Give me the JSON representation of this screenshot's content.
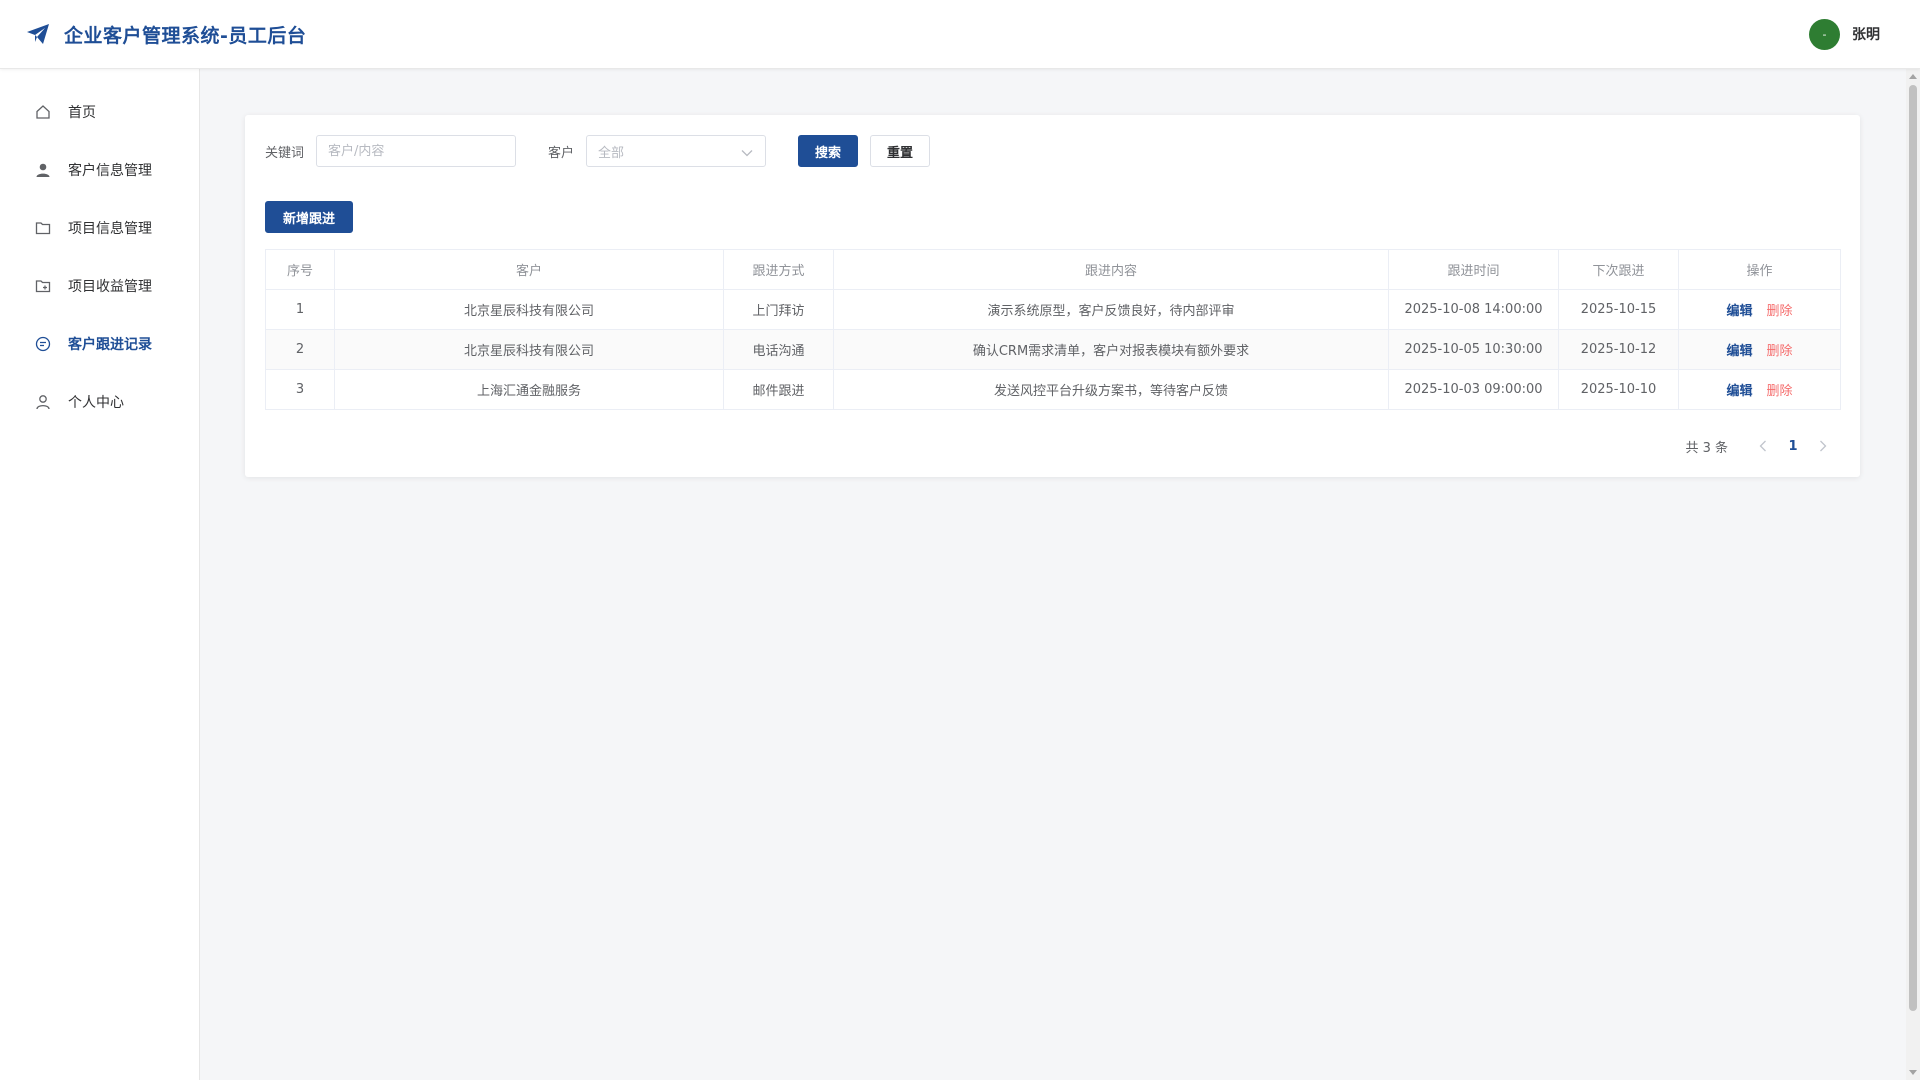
{
  "header": {
    "app_title": "企业客户管理系统-员工后台",
    "user_initial": "-",
    "user_name": "张明"
  },
  "sidebar": {
    "items": [
      {
        "label": "首页",
        "icon": "home-icon"
      },
      {
        "label": "客户信息管理",
        "icon": "user-icon"
      },
      {
        "label": "项目信息管理",
        "icon": "folder-icon"
      },
      {
        "label": "项目收益管理",
        "icon": "folder-add-icon"
      },
      {
        "label": "客户跟进记录",
        "icon": "chat-icon",
        "active": true
      },
      {
        "label": "个人中心",
        "icon": "user-outline-icon"
      }
    ]
  },
  "filters": {
    "keyword_label": "关键词",
    "keyword_placeholder": "客户/内容",
    "keyword_value": "",
    "customer_label": "客户",
    "customer_selected": "全部",
    "search_label": "搜索",
    "reset_label": "重置"
  },
  "add_button_label": "新增跟进",
  "table": {
    "headers": [
      "序号",
      "客户",
      "跟进方式",
      "跟进内容",
      "跟进时间",
      "下次跟进",
      "操作"
    ],
    "rows": [
      {
        "index": "1",
        "customer": "北京星辰科技有限公司",
        "method": "上门拜访",
        "content": "演示系统原型，客户反馈良好，待内部评审",
        "time": "2025-10-08 14:00:00",
        "next": "2025-10-15"
      },
      {
        "index": "2",
        "customer": "北京星辰科技有限公司",
        "method": "电话沟通",
        "content": "确认CRM需求清单，客户对报表模块有额外要求",
        "time": "2025-10-05 10:30:00",
        "next": "2025-10-12"
      },
      {
        "index": "3",
        "customer": "上海汇通金融服务",
        "method": "邮件跟进",
        "content": "发送风控平台升级方案书，等待客户反馈",
        "time": "2025-10-03 09:00:00",
        "next": "2025-10-10"
      }
    ],
    "edit_label": "编辑",
    "delete_label": "删除"
  },
  "pagination": {
    "total_text": "共 3 条",
    "current_page": "1"
  },
  "colors": {
    "primary": "#1f4e96",
    "danger": "#f56c6c",
    "avatar": "#2e7d32"
  }
}
